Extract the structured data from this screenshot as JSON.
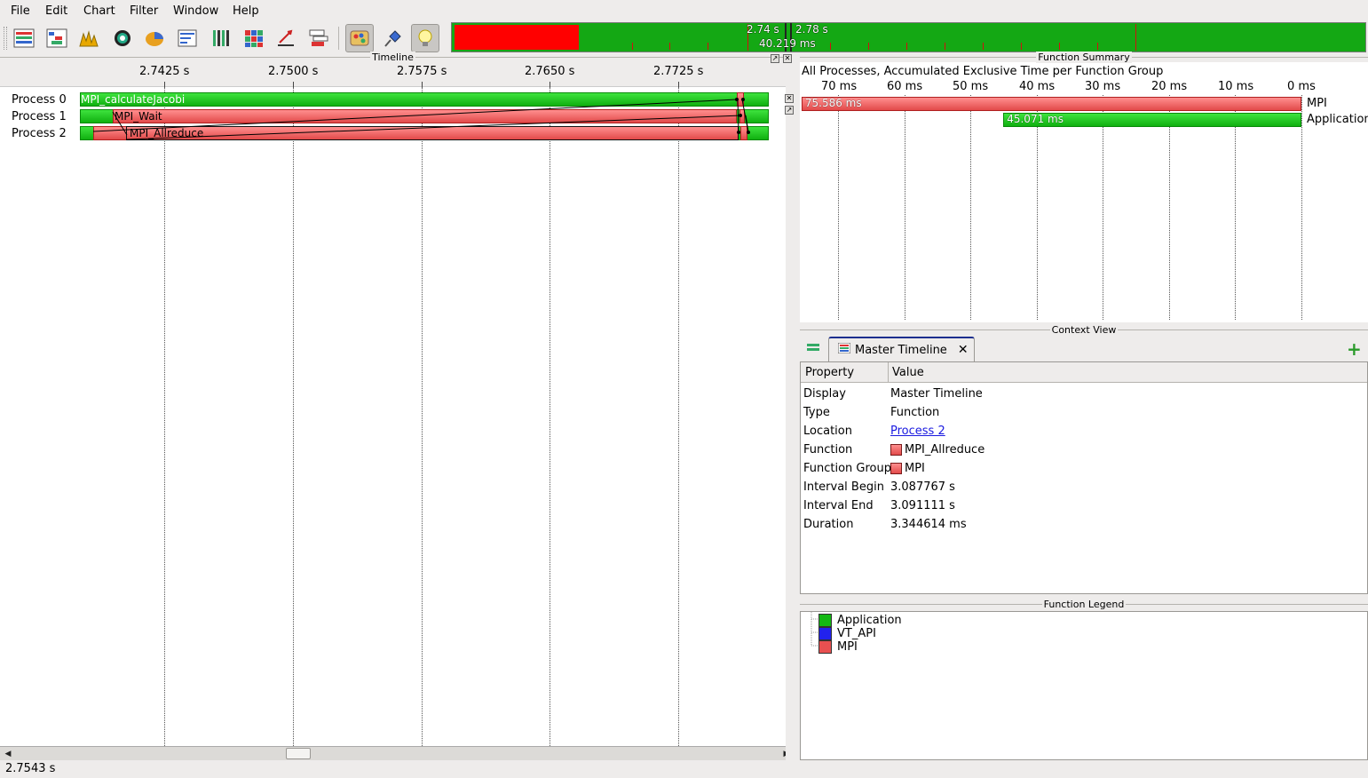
{
  "menubar": {
    "items": [
      {
        "label": "File"
      },
      {
        "label": "Edit"
      },
      {
        "label": "Chart"
      },
      {
        "label": "Filter"
      },
      {
        "label": "Window"
      },
      {
        "label": "Help"
      }
    ]
  },
  "toolbar": {
    "buttons": [
      {
        "icon": "master-timeline-icon"
      },
      {
        "icon": "process-timeline-icon"
      },
      {
        "icon": "counter-timeline-icon"
      },
      {
        "icon": "otf-function-icon"
      },
      {
        "icon": "summary-pie-icon"
      },
      {
        "icon": "message-summary-icon"
      },
      {
        "icon": "process-summary-icon"
      },
      {
        "icon": "communication-matrix-icon"
      },
      {
        "icon": "io-activity-icon"
      },
      {
        "icon": "call-tree-icon"
      },
      {
        "icon": "colors-icon"
      },
      {
        "icon": "pin-icon"
      },
      {
        "icon": "lightbulb-icon"
      }
    ]
  },
  "overview": {
    "left_time": "2.74 s",
    "right_time": "2.78 s",
    "duration": "40.219 ms",
    "colors": {
      "application": "#14a814",
      "mpi": "#ff0000"
    }
  },
  "timeline": {
    "title": "Timeline",
    "ticks": [
      "2.7425 s",
      "2.7500 s",
      "2.7575 s",
      "2.7650 s",
      "2.7725 s"
    ],
    "processes": [
      {
        "label": "Process 0",
        "bar_label": "MPI_calculateJacobi"
      },
      {
        "label": "Process 1",
        "bar_label": "MPI_Wait"
      },
      {
        "label": "Process 2",
        "bar_label": "MPI_Allreduce"
      }
    ]
  },
  "function_summary": {
    "title": "Function Summary",
    "subtitle": "All Processes, Accumulated Exclusive Time per Function Group",
    "ticks": [
      "70 ms",
      "60 ms",
      "50 ms",
      "40 ms",
      "30 ms",
      "20 ms",
      "10 ms",
      "0 ms"
    ],
    "chart_data": {
      "type": "bar",
      "orientation": "horizontal",
      "categories": [
        "MPI",
        "Application"
      ],
      "values": [
        75.586,
        45.071
      ],
      "value_labels": [
        "75.586 ms",
        "45.071 ms"
      ],
      "colors": [
        "#e24a4a",
        "#14a814"
      ],
      "xlim": [
        0,
        75.586
      ],
      "xaxis_direction": "reversed",
      "grid": true
    }
  },
  "context_view": {
    "title": "Context View",
    "tab_label": "Master Timeline",
    "columns": {
      "property": "Property",
      "value": "Value"
    },
    "rows": [
      {
        "key": "Display",
        "value": "Master Timeline"
      },
      {
        "key": "Type",
        "value": "Function"
      },
      {
        "key": "Location",
        "value": "Process 2"
      },
      {
        "key": "Function",
        "value": "MPI_Allreduce"
      },
      {
        "key": "Function Group",
        "value": "MPI"
      },
      {
        "key": "Interval Begin",
        "value": "3.087767 s"
      },
      {
        "key": "Interval End",
        "value": "3.091111 s"
      },
      {
        "key": "Duration",
        "value": "3.344614 ms"
      }
    ]
  },
  "function_legend": {
    "title": "Function Legend",
    "items": [
      {
        "label": "Application",
        "color": "#14b814"
      },
      {
        "label": "VT_API",
        "color": "#2222ee"
      },
      {
        "label": "MPI",
        "color": "#e85050"
      }
    ]
  },
  "status": {
    "text": "2.7543 s"
  }
}
